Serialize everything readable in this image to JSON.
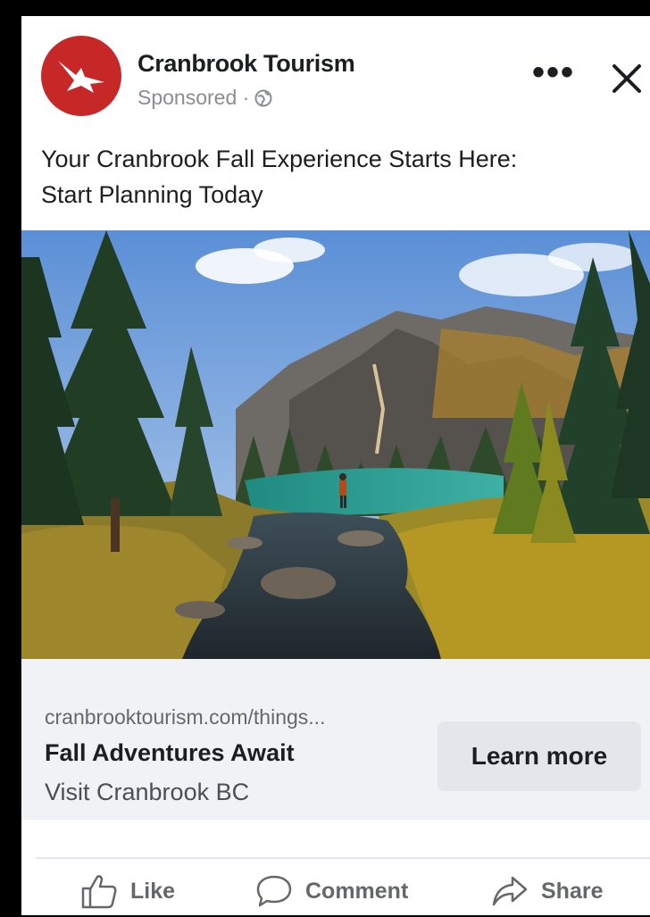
{
  "post": {
    "page_name": "Cranbrook Tourism",
    "sponsored": "Sponsored ·",
    "text_line1": "Your Cranbrook Fall Experience Starts Here:",
    "text_line2": "Start Planning Today",
    "photo_icon": "landscape-photo",
    "link": {
      "url": "cranbrooktourism.com/things...",
      "title": "Fall Adventures Await",
      "subtitle": "Visit Cranbrook BC",
      "cta": "Learn more"
    },
    "actions": {
      "like": "Like",
      "comment": "Comment",
      "share": "Share"
    }
  },
  "icons": {
    "logo": "bird-logo-icon",
    "globe": "globe-icon",
    "more": "more-options-icon",
    "close": "close-icon",
    "like": "thumbs-up-icon",
    "comment": "comment-bubble-icon",
    "share": "share-arrow-icon"
  },
  "colors": {
    "brand_red": "#c62828",
    "link_bg": "#f0f2f5",
    "button_bg": "#e4e6eb",
    "muted_text": "#65676b"
  }
}
